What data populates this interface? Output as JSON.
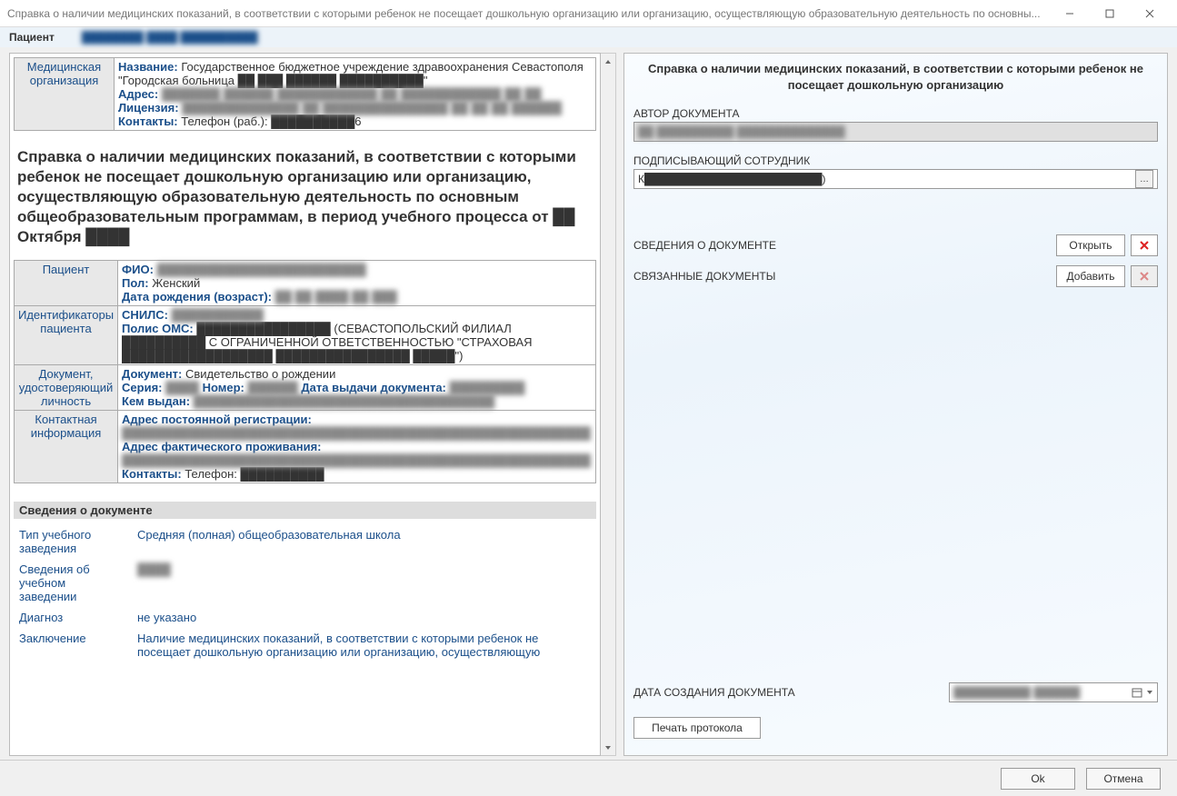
{
  "window": {
    "title": "Справка о наличии медицинских показаний, в соответствии с которыми ребенок не посещает дошкольную организацию или организацию, осуществляющую образовательную деятельность по основны..."
  },
  "patientbar": {
    "label": "Пациент",
    "value": "████████ ████ ██████████"
  },
  "org": {
    "side": "Медицинская организация",
    "name_label": "Название:",
    "name_value": "Государственное бюджетное учреждение здравоохранения Севастополя \"Городская больница ██ ███ ██████ ██████████\"",
    "addr_label": "Адрес:",
    "addr_value": "███████ ██████ ████████████ ██ ████████████ ██ ██",
    "lic_label": "Лицензия:",
    "lic_value": "██████████████ ██ ███████████████ ██ ██ ██ ██████",
    "contacts_label": "Контакты:",
    "contacts_value": "Телефон (раб.): ██████████6"
  },
  "mid_title": "Справка о наличии медицинских показаний, в соответствии с которыми ребенок не посещает дошкольную организацию или организацию, осуществляющую образовательную деятельность по основным общеобразовательным программам, в период учебного процесса от ██ Октября ████",
  "patient": {
    "side": "Пациент",
    "fio_label": "ФИО:",
    "fio_value": "█████████████████████████",
    "sex_label": "Пол:",
    "sex_value": "Женский",
    "dob_label": "Дата рождения (возраст):",
    "dob_value": "██ ██ ████ ██ ███"
  },
  "ids": {
    "side": "Идентификаторы пациента",
    "snils_label": "СНИЛС:",
    "snils_value": "███████████",
    "oms_label": "Полис ОМС:",
    "oms_value": "████████████████ (СЕВАСТОПОЛЬСКИЙ ФИЛИАЛ ██████████ С ОГРАНИЧЕННОЙ ОТВЕТСТВЕННОСТЬЮ \"СТРАХОВАЯ ██████████████████ ████████████████ █████\")"
  },
  "iddoc": {
    "side": "Документ, удостоверяющий личность",
    "doc_label": "Документ:",
    "doc_value": "Свидетельство о рождении",
    "ser_label": "Серия:",
    "ser_value": "████",
    "num_label": "Номер:",
    "num_value": "██████",
    "date_label": "Дата выдачи документа:",
    "date_value": "█████████",
    "issuer_label": "Кем выдан:",
    "issuer_value": "████████████████████████████████████"
  },
  "contact": {
    "side": "Контактная информация",
    "reg_label": "Адрес постоянной регистрации:",
    "reg_value": "████████████████████████████████████████████████████████",
    "fact_label": "Адрес фактического проживания:",
    "fact_value": "████████████████████████████████████████████████████████",
    "contacts_label": "Контакты:",
    "contacts_value": "Телефон: ██████████"
  },
  "docinfo_header": "Сведения о документе",
  "docinfo": {
    "type_label": "Тип учебного заведения",
    "type_value": "Средняя (полная) общеобразовательная школа",
    "school_label": "Сведения об учебном заведении",
    "school_value": "████",
    "diag_label": "Диагноз",
    "diag_value": "не указано",
    "concl_label": "Заключение",
    "concl_value": "Наличие медицинских показаний, в соответствии с которыми ребенок не посещает дошкольную организацию или организацию, осуществляющую"
  },
  "right": {
    "title": "Справка о наличии медицинских показаний, в соответствии с которыми ребенок не посещает дошкольную организацию",
    "author_label": "АВТОР ДОКУМЕНТА",
    "author_value": "██ ██████████ ██████████████",
    "signer_label": "ПОДПИСЫВАЮЩИЙ СОТРУДНИК",
    "signer_value": "К███████████████████████)",
    "docprops_label": "СВЕДЕНИЯ О ДОКУМЕНТЕ",
    "open_btn": "Открыть",
    "linked_label": "СВЯЗАННЫЕ ДОКУМЕНТЫ",
    "add_btn": "Добавить",
    "date_label": "ДАТА СОЗДАНИЯ ДОКУМЕНТА",
    "date_value": "██████████ ██████",
    "print_btn": "Печать протокола"
  },
  "footer": {
    "ok": "Ok",
    "cancel": "Отмена"
  }
}
